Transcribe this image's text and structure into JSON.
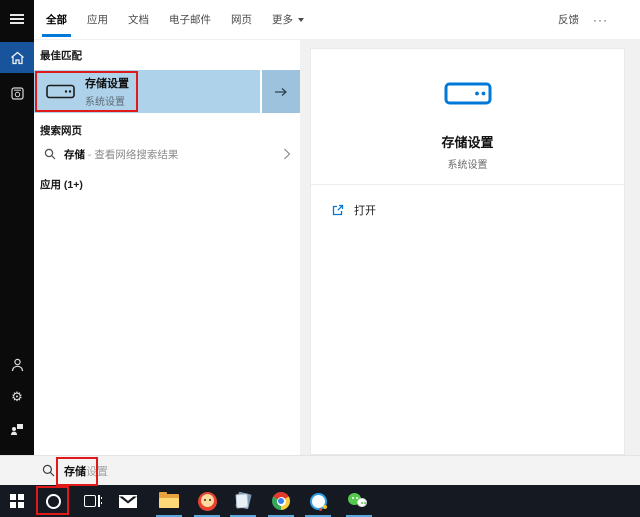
{
  "colors": {
    "accent_blue": "#0078d7",
    "highlight_blue": "#aed2ea",
    "highlight_arrow_blue": "#9cc2de",
    "rail_black": "#0b0b0b",
    "home_block_blue": "#17549c",
    "panel_gray": "#f1f1f1",
    "taskbar_dark": "#151922",
    "annotation_red": "#e01a1a",
    "running_indicator_blue": "#5aa7de"
  },
  "header": {
    "tabs": [
      {
        "label": "全部",
        "active": true
      },
      {
        "label": "应用",
        "active": false
      },
      {
        "label": "文档",
        "active": false
      },
      {
        "label": "电子邮件",
        "active": false
      },
      {
        "label": "网页",
        "active": false
      },
      {
        "label": "更多",
        "active": false,
        "has_dropdown": true
      }
    ],
    "feedback_label": "反馈",
    "overflow_label": "···"
  },
  "rail": {
    "icons": [
      "hamburger-menu",
      "home",
      "journal",
      "account",
      "settings",
      "feedback-people"
    ]
  },
  "results": {
    "best_match_header": "最佳匹配",
    "best_match": {
      "title": "存储设置",
      "subtitle": "系统设置",
      "icon": "storage-drive-icon"
    },
    "web_header": "搜索网页",
    "web_result": {
      "query": "存储",
      "suffix": "- 查看网络搜索结果",
      "icon": "search-icon"
    },
    "apps_header": "应用 (1+)"
  },
  "preview": {
    "icon": "storage-drive-icon",
    "title": "存储设置",
    "subtitle": "系统设置",
    "open_label": "打开"
  },
  "search_bar": {
    "typed": "存储",
    "suggestion": "设置",
    "icon": "search-icon"
  },
  "taskbar": {
    "icons": [
      "windows-start",
      "cortana",
      "task-view",
      "mail",
      "file-explorer",
      "orange-app",
      "notepad",
      "chrome",
      "qq",
      "wechat"
    ],
    "running": [
      "file-explorer",
      "orange-app",
      "notepad",
      "chrome",
      "qq",
      "wechat"
    ]
  },
  "annotations": [
    "best-match-red-box",
    "search-text-red-box",
    "cortana-red-box"
  ]
}
